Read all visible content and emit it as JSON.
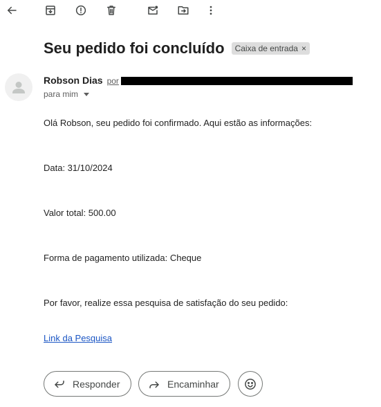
{
  "toolbar": {
    "icons": [
      "back-arrow-icon",
      "archive-icon",
      "report-spam-icon",
      "delete-icon",
      "mark-unread-icon",
      "move-to-icon",
      "more-options-icon"
    ]
  },
  "email": {
    "subject": "Seu pedido foi concluído",
    "label": "Caixa de entrada",
    "label_remove": "×",
    "sender_name": "Robson Dias",
    "sender_via": "por",
    "recipient": "para mim",
    "body": {
      "greeting": "Olá Robson, seu pedido foi confirmado. Aqui estão as informações:",
      "date": "Data: 31/10/2024",
      "total": "Valor total: 500.00",
      "payment": "Forma de pagamento utilizada: Cheque",
      "survey_request": "Por favor, realize essa pesquisa de satisfação do seu pedido:",
      "survey_link": "Link da Pesquisa"
    }
  },
  "actions": {
    "reply": "Responder",
    "forward": "Encaminhar"
  },
  "colors": {
    "link": "#1a55c4",
    "label_bg": "#dddddd",
    "redaction": "#000000"
  }
}
